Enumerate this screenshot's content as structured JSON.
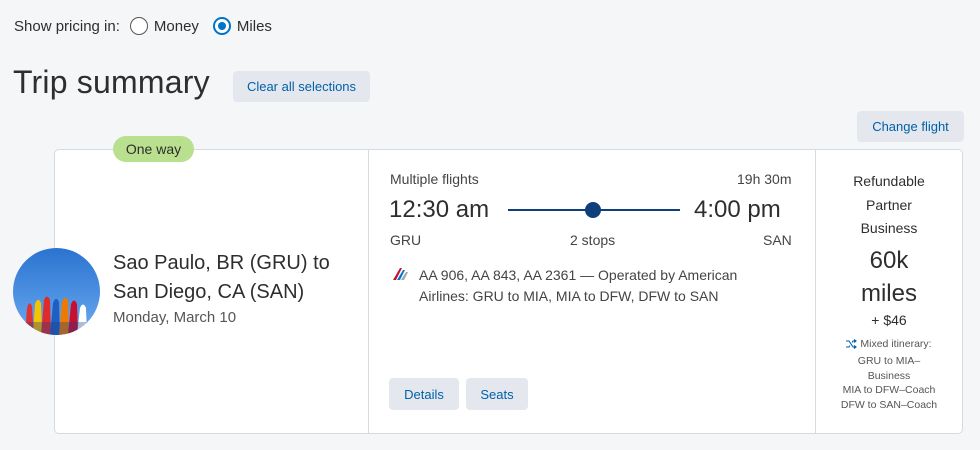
{
  "pricing": {
    "label": "Show pricing in:",
    "options": [
      {
        "label": "Money",
        "selected": false
      },
      {
        "label": "Miles",
        "selected": true
      }
    ]
  },
  "page_title": "Trip summary",
  "clear_button": "Clear all selections",
  "change_button": "Change flight",
  "trip": {
    "badge": "One way",
    "route_line1": "Sao Paulo, BR (GRU) to",
    "route_line2": "San Diego, CA (SAN)",
    "date": "Monday, March 10"
  },
  "flight": {
    "type": "Multiple flights",
    "duration": "19h 30m",
    "depart_time": "12:30 am",
    "arrive_time": "4:00 pm",
    "depart_code": "GRU",
    "arrive_code": "SAN",
    "stops": "2 stops",
    "details": "AA 906, AA 843, AA 2361 — Operated by American Airlines: GRU to MIA, MIA to DFW, DFW to SAN",
    "details_button": "Details",
    "seats_button": "Seats"
  },
  "fare": {
    "line1": "Refundable",
    "line2": "Partner",
    "line3": "Business",
    "miles_value": "60k",
    "miles_unit": "miles",
    "tax": "+ $46",
    "mixed_title": "Mixed itinerary:",
    "mixed_lines": [
      "GRU to MIA–",
      "Business",
      "MIA to DFW–Coach",
      "DFW to SAN–Coach"
    ]
  },
  "colors": {
    "accent": "#0074c8",
    "badge": "#b9e08e",
    "timeline": "#0f3f7a"
  }
}
